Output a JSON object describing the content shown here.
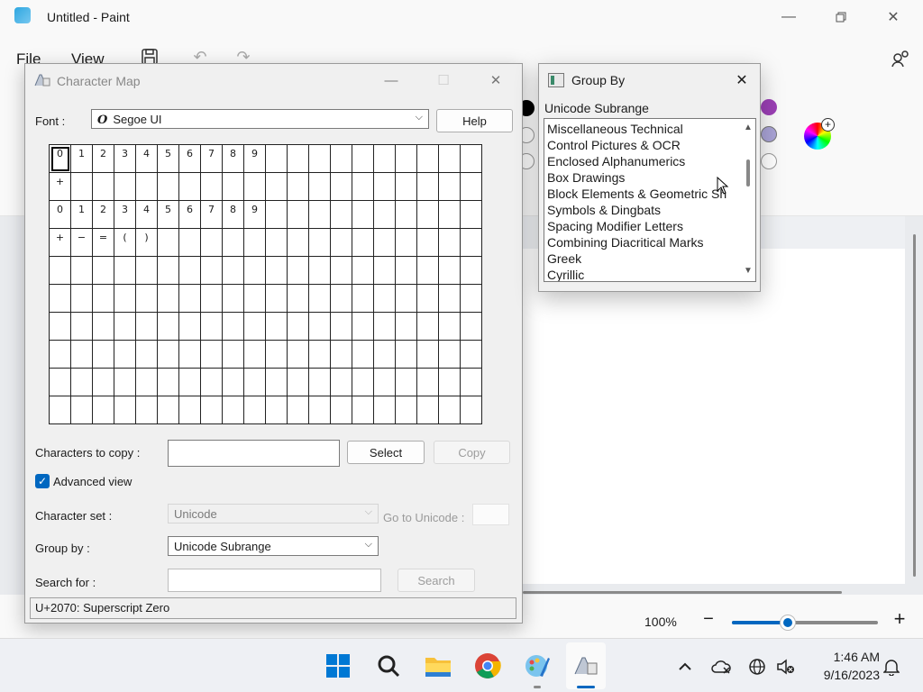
{
  "paint": {
    "title": "Untitled - Paint",
    "menu": {
      "file": "File",
      "view": "View"
    },
    "zoom": {
      "label": "100%",
      "level_percent": 100,
      "slider_fraction": 0.38
    },
    "partial_size": "975 × 400px"
  },
  "charmap": {
    "title": "Character Map",
    "font_label": "Font :",
    "font_value": "Segoe UI",
    "font_glyph": "O",
    "help_label": "Help",
    "grid_rows": [
      [
        "0",
        "1",
        "2",
        "3",
        "4",
        "5",
        "6",
        "7",
        "8",
        "9",
        "",
        "",
        "",
        "",
        "",
        "",
        "",
        "",
        "",
        ""
      ],
      [
        "+",
        "",
        "",
        "",
        "",
        "",
        "",
        "",
        "",
        "",
        "",
        "",
        "",
        "",
        "",
        "",
        "",
        "",
        "",
        ""
      ],
      [
        "0",
        "1",
        "2",
        "3",
        "4",
        "5",
        "6",
        "7",
        "8",
        "9",
        "",
        "",
        "",
        "",
        "",
        "",
        "",
        "",
        "",
        ""
      ],
      [
        "+",
        "−",
        "=",
        "(",
        ")",
        "",
        "",
        "",
        "",
        "",
        "",
        "",
        "",
        "",
        "",
        "",
        "",
        "",
        "",
        ""
      ],
      [
        "",
        "",
        "",
        "",
        "",
        "",
        "",
        "",
        "",
        "",
        "",
        "",
        "",
        "",
        "",
        "",
        "",
        "",
        "",
        ""
      ],
      [
        "",
        "",
        "",
        "",
        "",
        "",
        "",
        "",
        "",
        "",
        "",
        "",
        "",
        "",
        "",
        "",
        "",
        "",
        "",
        ""
      ],
      [
        "",
        "",
        "",
        "",
        "",
        "",
        "",
        "",
        "",
        "",
        "",
        "",
        "",
        "",
        "",
        "",
        "",
        "",
        "",
        ""
      ],
      [
        "",
        "",
        "",
        "",
        "",
        "",
        "",
        "",
        "",
        "",
        "",
        "",
        "",
        "",
        "",
        "",
        "",
        "",
        "",
        ""
      ],
      [
        "",
        "",
        "",
        "",
        "",
        "",
        "",
        "",
        "",
        "",
        "",
        "",
        "",
        "",
        "",
        "",
        "",
        "",
        "",
        ""
      ],
      [
        "",
        "",
        "",
        "",
        "",
        "",
        "",
        "",
        "",
        "",
        "",
        "",
        "",
        "",
        "",
        "",
        "",
        "",
        "",
        ""
      ]
    ],
    "chars_to_copy_label": "Characters to copy :",
    "chars_to_copy_value": "",
    "select_label": "Select",
    "copy_label": "Copy",
    "advanced_view_label": "Advanced view",
    "advanced_view_checked": true,
    "charset_label": "Character set :",
    "charset_value": "Unicode",
    "goto_unicode_label": "Go to Unicode :",
    "groupby_label": "Group by :",
    "groupby_value": "Unicode Subrange",
    "search_label": "Search for :",
    "search_value": "",
    "search_button": "Search",
    "status": "U+2070: Superscript Zero"
  },
  "groupby_window": {
    "title": "Group By",
    "heading": "Unicode Subrange",
    "items": [
      "Miscellaneous Technical",
      "Control Pictures & OCR",
      "Enclosed Alphanumerics",
      "Box Drawings",
      "Block Elements & Geometric Sh",
      "Symbols & Dingbats",
      "Spacing Modifier Letters",
      "Combining Diacritical Marks",
      "Greek",
      "Cyrillic"
    ]
  },
  "taskbar": {
    "time": "1:46 AM",
    "date": "9/16/2023"
  },
  "colors": {
    "accent": "#0067c0",
    "palette_purple": "#9b3fb5",
    "palette_lavender": "#a9a3d6"
  }
}
